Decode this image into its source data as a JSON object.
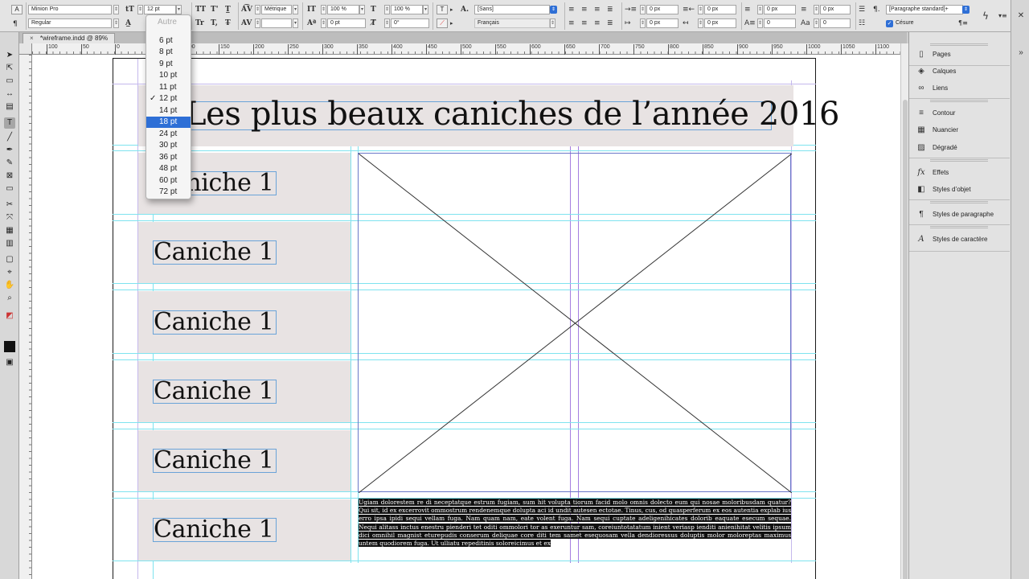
{
  "control_bar": {
    "font_family": "Minion Pro",
    "font_style": "Regular",
    "font_size": "12 pt",
    "kerning": "Métrique",
    "vertical_scale": "100 %",
    "horizontal_scale": "100 %",
    "baseline_shift": "0 pt",
    "skew": "0°",
    "character_style": "[Sans]",
    "language": "Français",
    "left_indent": "0 px",
    "first_line_indent": "0 px",
    "right_indent": "0 px",
    "last_line_indent": "0 px",
    "space_before": "0 px",
    "space_after": "0 px",
    "drop_cap_lines": "0",
    "drop_cap_chars": "0",
    "paragraph_style": "[Paragraphe standard]+",
    "hyphenation_label": "Césure",
    "tracking_prefix_a": "A",
    "case_icons": [
      "TT",
      "T'",
      "T",
      "Tr",
      "T,",
      "T"
    ]
  },
  "document_tab": {
    "title": "*wireframe.indd @ 89%",
    "close": "×"
  },
  "ruler": {
    "labels": [
      "100",
      "50",
      "0",
      "50",
      "100",
      "150",
      "200",
      "250",
      "300",
      "350",
      "400",
      "450",
      "500",
      "550",
      "600",
      "650",
      "700",
      "750",
      "800",
      "850",
      "900",
      "950",
      "1000",
      "1050",
      "1100"
    ]
  },
  "font_size_dropdown": {
    "header": "Autre",
    "options": [
      "6 pt",
      "8 pt",
      "9 pt",
      "10 pt",
      "11 pt",
      "12 pt",
      "14 pt",
      "18 pt",
      "24 pt",
      "30 pt",
      "36 pt",
      "48 pt",
      "60 pt",
      "72 pt"
    ],
    "checked": "12 pt",
    "highlighted": "18 pt",
    "check_glyph": "✓"
  },
  "page": {
    "title": "Les plus beaux caniches de l’année 2016",
    "rows": [
      "Caniche 1",
      "Caniche 1",
      "Caniche 1",
      "Caniche 1",
      "Caniche 1",
      "Caniche 1"
    ],
    "body_text": "Ugiam dolorestem re di neceptatque estrum fugiam, sum hit volupta tiorum facid molo omnis dolecto eum qui nosae moloribusdam quatur? Qui sit, id ex excerrovit ommostrum rendenemque dolupta aci id undit autesen ectotae. Tinus, cus, od quasperferum ex eos autentia explab ius erro ipsa ipidi sequi vellam fuga. Nam quam nam, eate volent fuga. Nam sequi cuptate adeligenihicates dolorib eaquate esecum sequae. Nequi alitass inctus enestru pienderi tet oditi ommolori tor as exeruntur sam, coreiuntotatatum inient veriasp ienditi anienihitat velitis ipsum dici omnihil magnist eturepudis conserum deliquae core diti tem samet esequosam vella dendioressus doluptis molor moloreptas maximus untem quodiorem fuga. Ut ulliatu repeditinis soloreicimus et ex"
  },
  "panels": {
    "items": [
      {
        "label": "Pages",
        "icon": "pages-icon",
        "glyph": "▯"
      },
      {
        "label": "Calques",
        "icon": "layers-icon",
        "glyph": "◈"
      },
      {
        "label": "Liens",
        "icon": "links-icon",
        "glyph": "∞"
      },
      {
        "label": "Contour",
        "icon": "stroke-icon",
        "glyph": "≡"
      },
      {
        "label": "Nuancier",
        "icon": "swatches-icon",
        "glyph": "▦"
      },
      {
        "label": "Dégradé",
        "icon": "gradient-icon",
        "glyph": "▨"
      },
      {
        "label": "Effets",
        "icon": "effects-icon",
        "glyph": "fx"
      },
      {
        "label": "Styles d’objet",
        "icon": "object-styles-icon",
        "glyph": "◧"
      },
      {
        "label": "Styles de paragraphe",
        "icon": "paragraph-styles-icon",
        "glyph": "¶"
      },
      {
        "label": "Styles de caractère",
        "icon": "character-styles-icon",
        "glyph": "A"
      }
    ]
  },
  "colors": {
    "selection_blue": "#2e6fd6",
    "guide_cyan": "#7fe3ef",
    "margin_purple": "#a57de0",
    "frame_fill": "#e8e3e3"
  }
}
